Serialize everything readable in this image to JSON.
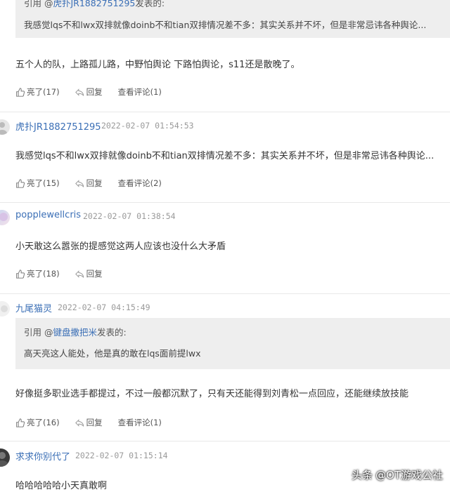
{
  "top_quote": {
    "prefix": "引用 @",
    "author": "虎扑JR1882751295",
    "suffix": "发表的:",
    "body": "我感觉lqs不和lwx双排就像doinb不和tian双排情况差不多：其实关系并不坏，但是非常忌讳各种舆论..."
  },
  "first_reply": {
    "content": "五个人的队，上路孤儿路，中野怕舆论 下路怕舆论，s11还是散晚了。",
    "like_label": "亮了(17)",
    "reply_label": "回复",
    "view_label": "查看评论(1)"
  },
  "replies": [
    {
      "username": "虎扑JR1882751295",
      "time": "2022-02-07 01:54:53",
      "content": "我感觉lqs不和lwx双排就像doinb不和tian双排情况差不多：其实关系并不坏，但是非常忌讳各种舆论...",
      "like_label": "亮了(15)",
      "reply_label": "回复",
      "view_label": "查看评论(2)"
    },
    {
      "username": "popplewellcris",
      "time": "2022-02-07 01:38:54",
      "content": "小天敢这么嚣张的提感觉这两人应该也没什么大矛盾",
      "like_label": "亮了(18)",
      "reply_label": "回复"
    },
    {
      "username": "九尾猫灵",
      "time": "2022-02-07 04:15:49",
      "quote": {
        "prefix": "引用 @",
        "author": "键盘撒把米",
        "suffix": "发表的:",
        "body": "高天亮这人能处，他是真的敢在lqs面前提lwx"
      },
      "content": "好像挺多职业选手都提过，不过一般都沉默了，只有天还能得到刘青松一点回应，还能继续放技能",
      "like_label": "亮了(16)",
      "reply_label": "回复",
      "view_label": "查看评论(1)"
    },
    {
      "username": "求求你别代了",
      "time": "2022-02-07 01:15:14",
      "content": "哈哈哈哈哈小天真敢啊"
    }
  ],
  "watermark": {
    "source": "头条",
    "author": "@OT游戏公社"
  },
  "colors": {
    "link": "#3b6fb6",
    "quote_bg": "#eeeeee",
    "divider": "#e8e8e8"
  }
}
